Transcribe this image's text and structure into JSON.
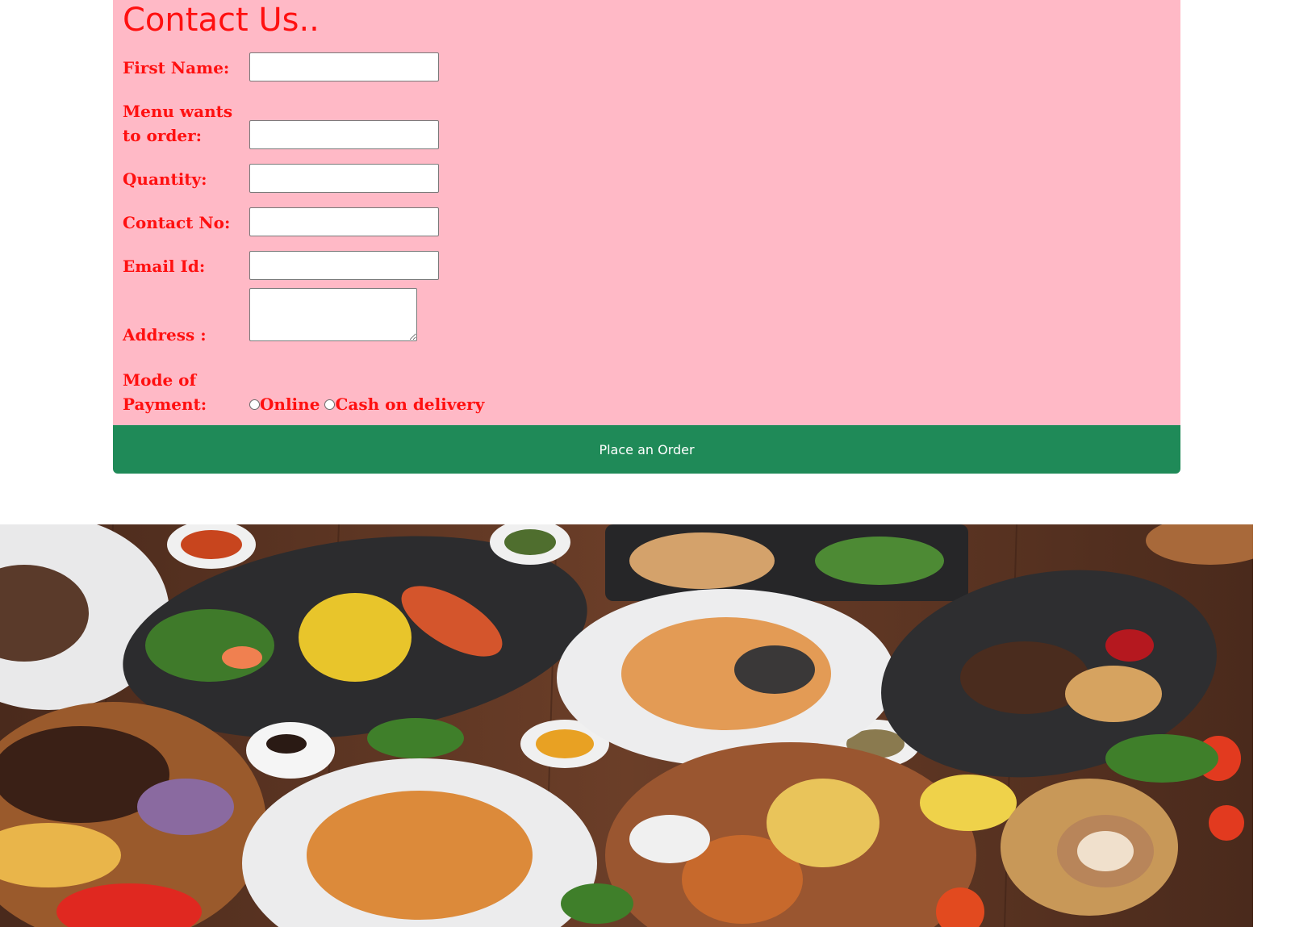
{
  "form": {
    "title": "Contact Us..",
    "fields": [
      {
        "label": "First Name:",
        "value": ""
      },
      {
        "label": "Menu wants to order:",
        "value": ""
      },
      {
        "label": "Quantity:",
        "value": ""
      },
      {
        "label": "Contact No:",
        "value": ""
      },
      {
        "label": "Email Id:",
        "value": ""
      }
    ],
    "address_label": "Address :",
    "address_value": "",
    "payment_label": "Mode of Payment:",
    "payment_options": [
      "Online",
      "Cash on delivery"
    ],
    "submit_label": "Place an Order"
  },
  "colors": {
    "panel_bg": "#ffb9c6",
    "label_text": "#ff1010",
    "button_bg": "#1f8a58",
    "button_text": "#ffffff"
  },
  "hero_image": {
    "icon": "food-table-photo"
  }
}
